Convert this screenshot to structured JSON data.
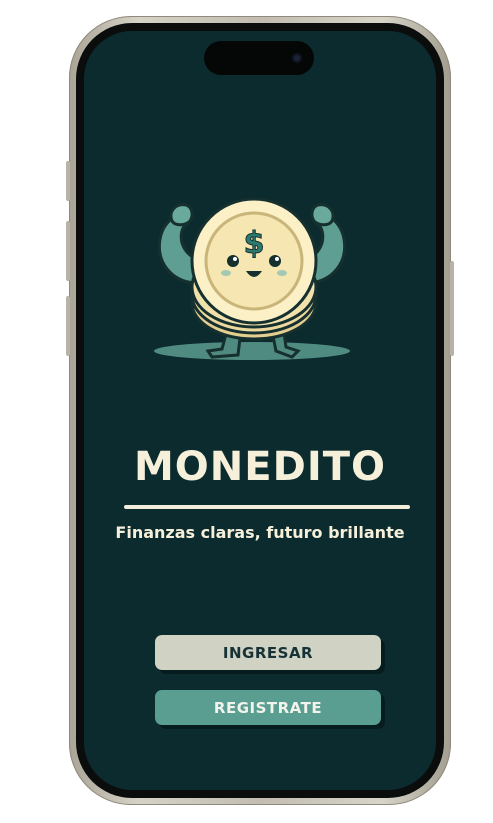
{
  "app": {
    "title": "MONEDITO",
    "tagline": "Finanzas claras, futuro brillante"
  },
  "buttons": {
    "login_label": "INGRESAR",
    "register_label": "REGISTRATE"
  },
  "mascot": {
    "symbol": "$",
    "icon": "coin-mascot-icon"
  },
  "colors": {
    "screen_background": "#0c2b2e",
    "title_text": "#f6f0db",
    "login_button": "#d0d2c3",
    "register_button": "#5a9d91",
    "coin_gold": "#f3e4b0",
    "mascot_teal": "#5f9f93"
  }
}
